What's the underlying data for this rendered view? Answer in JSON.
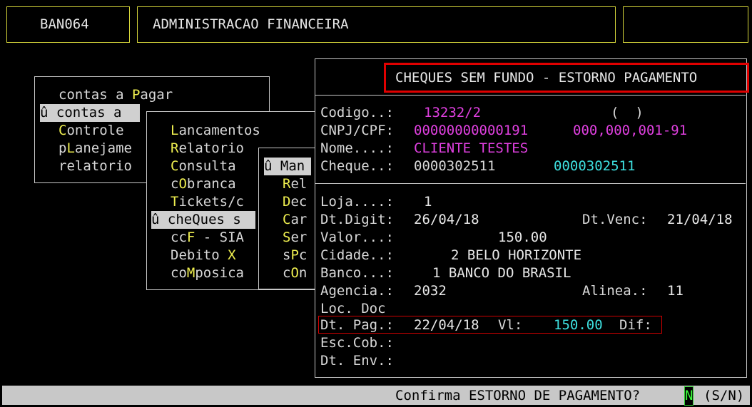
{
  "header": {
    "program_code": "BAN064",
    "title": "ADMINISTRACAO FINANCEIRA"
  },
  "menu1": {
    "items": [
      {
        "pre": "contas a ",
        "hot": "P",
        "post": "agar",
        "selected": false
      },
      {
        "pre": "û contas a ",
        "hot": "",
        "post": "",
        "selected": true
      },
      {
        "pre": "",
        "hot": "C",
        "post": "ontrole",
        "selected": false
      },
      {
        "pre": "p",
        "hot": "L",
        "post": "anejame",
        "selected": false
      },
      {
        "pre": "relatorio",
        "hot": "",
        "post": "",
        "selected": false
      }
    ]
  },
  "menu2": {
    "items": [
      {
        "pre": "",
        "hot": "L",
        "post": "ancamentos"
      },
      {
        "pre": "",
        "hot": "R",
        "post": "elatorio"
      },
      {
        "pre": "",
        "hot": "C",
        "post": "onsulta"
      },
      {
        "pre": "c",
        "hot": "O",
        "post": "branca"
      },
      {
        "pre": "",
        "hot": "T",
        "post": "ickets/c"
      },
      {
        "pre": "û che",
        "hot": "Q",
        "post": "ues s",
        "selected": true
      },
      {
        "pre": "cc",
        "hot": "F",
        "post": " - SIA"
      },
      {
        "pre": "Debito ",
        "hot": "X",
        "post": ""
      },
      {
        "pre": "co",
        "hot": "M",
        "post": "posica"
      }
    ]
  },
  "menu3": {
    "items": [
      {
        "pre": "û Man",
        "hot": "",
        "post": "",
        "selected": true
      },
      {
        "pre": "",
        "hot": "R",
        "post": "el"
      },
      {
        "pre": "",
        "hot": "D",
        "post": "ec"
      },
      {
        "pre": "",
        "hot": "C",
        "post": "ar"
      },
      {
        "pre": "",
        "hot": "S",
        "post": "er"
      },
      {
        "pre": "s",
        "hot": "P",
        "post": "c"
      },
      {
        "pre": "c",
        "hot": "O",
        "post": "n"
      }
    ]
  },
  "form": {
    "title": "CHEQUES SEM FUNDO - ESTORNO PAGAMENTO",
    "codigo": {
      "label": "Codigo..:",
      "value": "13232/2",
      "extra": "(  )"
    },
    "cnpj": {
      "label": "CNPJ/CPF:",
      "value": "00000000000191",
      "formatted": "000,000,001-91"
    },
    "nome": {
      "label": "Nome....:",
      "value": "CLIENTE TESTES"
    },
    "cheque": {
      "label": "Cheque..:",
      "value": "0000302511",
      "value2": "0000302511"
    },
    "loja": {
      "label": "Loja....:",
      "value": "1"
    },
    "dt_digit": {
      "label": "Dt.Digit:",
      "value": "26/04/18"
    },
    "dt_venc": {
      "label": "Dt.Venc:",
      "value": "21/04/18"
    },
    "valor": {
      "label": "Valor...:",
      "value": "150.00"
    },
    "cidade": {
      "label": "Cidade..:",
      "value": "2 BELO HORIZONTE"
    },
    "banco": {
      "label": "Banco...:",
      "value": "1 BANCO DO BRASIL"
    },
    "agencia": {
      "label": "Agencia.:",
      "value": "2032"
    },
    "alinea": {
      "label": "Alinea.:",
      "value": "11"
    },
    "loc_doc": {
      "label": "Loc. Doc"
    },
    "dt_pag": {
      "label": "Dt. Pag.:",
      "value": "22/04/18",
      "vl_label": "Vl:",
      "vl_value": "150.00",
      "dif_label": "Dif:"
    },
    "esc_cob": {
      "label": "Esc.Cob.:"
    },
    "dt_env": {
      "label": "Dt. Env.:"
    }
  },
  "status": {
    "prompt": "Confirma ESTORNO DE PAGAMENTO?",
    "input": "N",
    "options": "(S/N)"
  }
}
